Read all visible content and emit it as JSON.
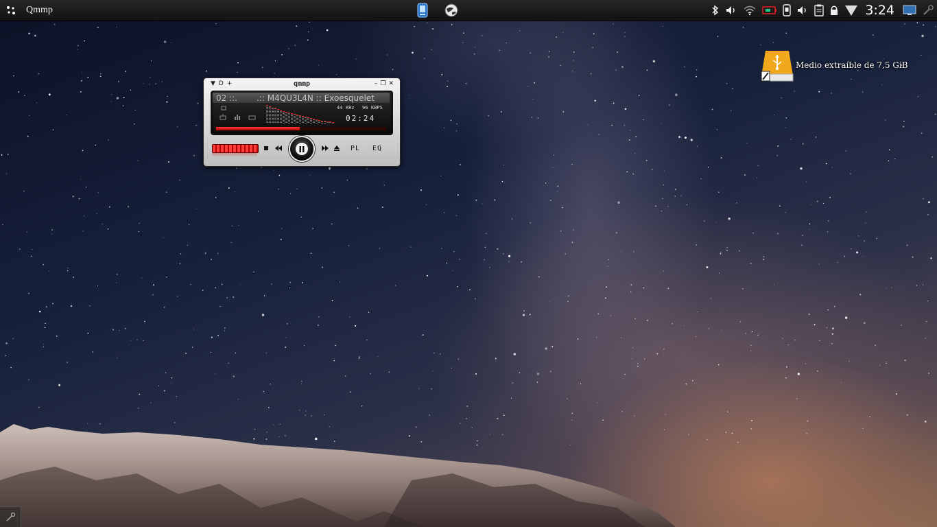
{
  "panel": {
    "app_title": "Qmmp",
    "clock": "3:24",
    "launcher_icon": "menu-launcher-icon",
    "task_icons": [
      "file-manager-icon",
      "browser-globe-icon"
    ],
    "tray_icons": [
      "bluetooth-icon",
      "volume-icon",
      "wifi-icon",
      "battery-icon",
      "phone-icon",
      "volume-icon",
      "clipboard-icon",
      "lock-icon",
      "network-signal-icon",
      "monitor-icon",
      "settings-wrench-icon"
    ]
  },
  "desktop_icon": {
    "label": "Medio extraíble de 7,5 GiB",
    "icon": "usb-drive-icon"
  },
  "player": {
    "window_title": "qmmp",
    "track_number": "02 ::.",
    "track_text": ".:: M4QU3L4N :: Exoesquelet",
    "khz": "44",
    "khz_unit": "KHz",
    "kbps": "96",
    "kbps_unit": "KBPS",
    "time": "02:24",
    "progress_fraction": 0.49,
    "volume_fraction": 1.0,
    "buttons": {
      "playlist": "PL",
      "equalizer": "EQ"
    }
  },
  "colors": {
    "accent_red": "#e01818",
    "panel_bg": "#1a1a1a",
    "usb_orange": "#f2a81d"
  }
}
